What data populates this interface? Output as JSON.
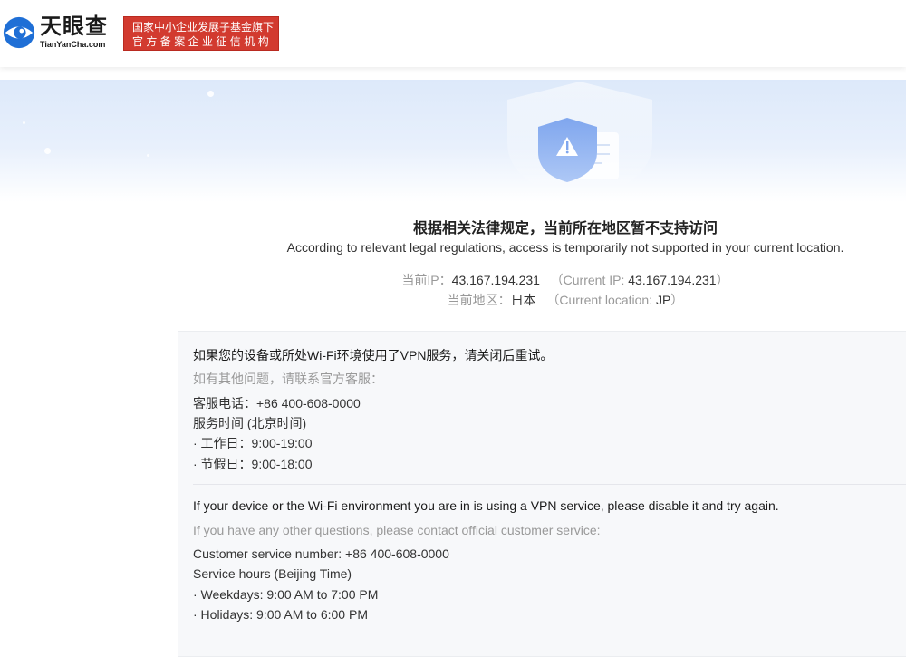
{
  "header": {
    "logo_cn": "天眼查",
    "logo_en": "TianYanCha.com",
    "badge_line1": "国家中小企业发展子基金旗下",
    "badge_line2": "官方备案企业征信机构"
  },
  "notice": {
    "title_cn": "根据相关法律规定，当前所在地区暂不支持访问",
    "title_en": "According to relevant legal regulations, access is temporarily not supported in your current location.",
    "ip_label": "当前IP：",
    "ip_value": "43.167.194.231",
    "ip_en_prefix": "（Current IP: ",
    "ip_en_value": "43.167.194.231",
    "ip_en_suffix": "）",
    "region_label": "当前地区：",
    "region_value": "日本",
    "region_en_prefix": "（Current location: ",
    "region_en_value": "JP",
    "region_en_suffix": "）"
  },
  "info_cn": {
    "vpn_tip": "如果您的设备或所处Wi-Fi环境使用了VPN服务，请关闭后重试。",
    "contact_hint": "如有其他问题，请联系官方客服：",
    "phone": "客服电话：+86 400-608-0000",
    "hours_title": "服务时间 (北京时间)",
    "workday": "· 工作日：9:00-19:00",
    "holiday": "· 节假日：9:00-18:00"
  },
  "info_en": {
    "vpn_tip": "If your device or the Wi-Fi environment you are in is using a VPN service, please disable it and try again.",
    "contact_hint": "If you have any other questions, please contact official customer service:",
    "phone": "Customer service number: +86 400-608-0000",
    "hours_title": "Service hours (Beijing Time)",
    "weekdays": "· Weekdays: 9:00 AM to 7:00 PM",
    "holidays": "· Holidays: 9:00 AM to 6:00 PM"
  },
  "icons": {
    "logo": "tianyancha-eye-logo",
    "hero": "warning-shield-icon"
  },
  "colors": {
    "brand_blue": "#1f6fd6",
    "badge_red": "#d23a2f"
  }
}
